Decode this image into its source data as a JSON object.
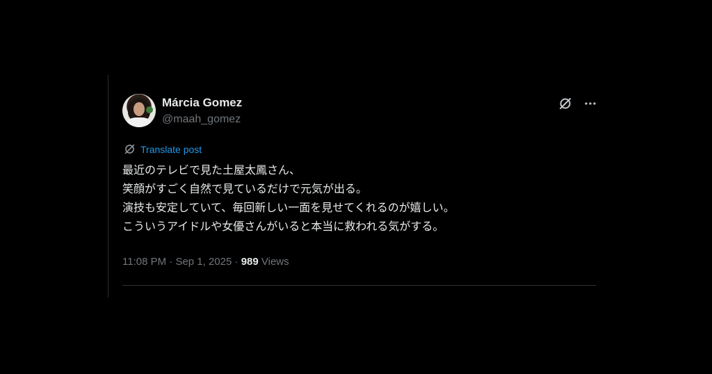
{
  "author": {
    "display_name": "Márcia Gomez",
    "handle": "@maah_gomez"
  },
  "actions": {
    "grok_icon": "slashed-circle-icon",
    "more_icon": "more-horizontal-icon",
    "more_label": "···"
  },
  "translate": {
    "label": "Translate post",
    "icon": "translate-slashed-circle-icon",
    "color": "#1d9bf0"
  },
  "post": {
    "lines": [
      "最近のテレビで見た土屋太鳳さん、",
      "笑顔がすごく自然で見ているだけで元気が出る。",
      "演技も安定していて、毎回新しい一面を見せてくれるのが嬉しい。",
      "こういうアイドルや女優さんがいると本当に救われる気がする。"
    ]
  },
  "meta": {
    "time": "11:08 PM",
    "sep1": " · ",
    "date": "Sep 1, 2025",
    "sep2": " · ",
    "views_count": "989",
    "views_label": " Views"
  },
  "colors": {
    "background": "#000000",
    "text": "#e7e9ea",
    "muted": "#71767b",
    "link": "#1d9bf0"
  }
}
